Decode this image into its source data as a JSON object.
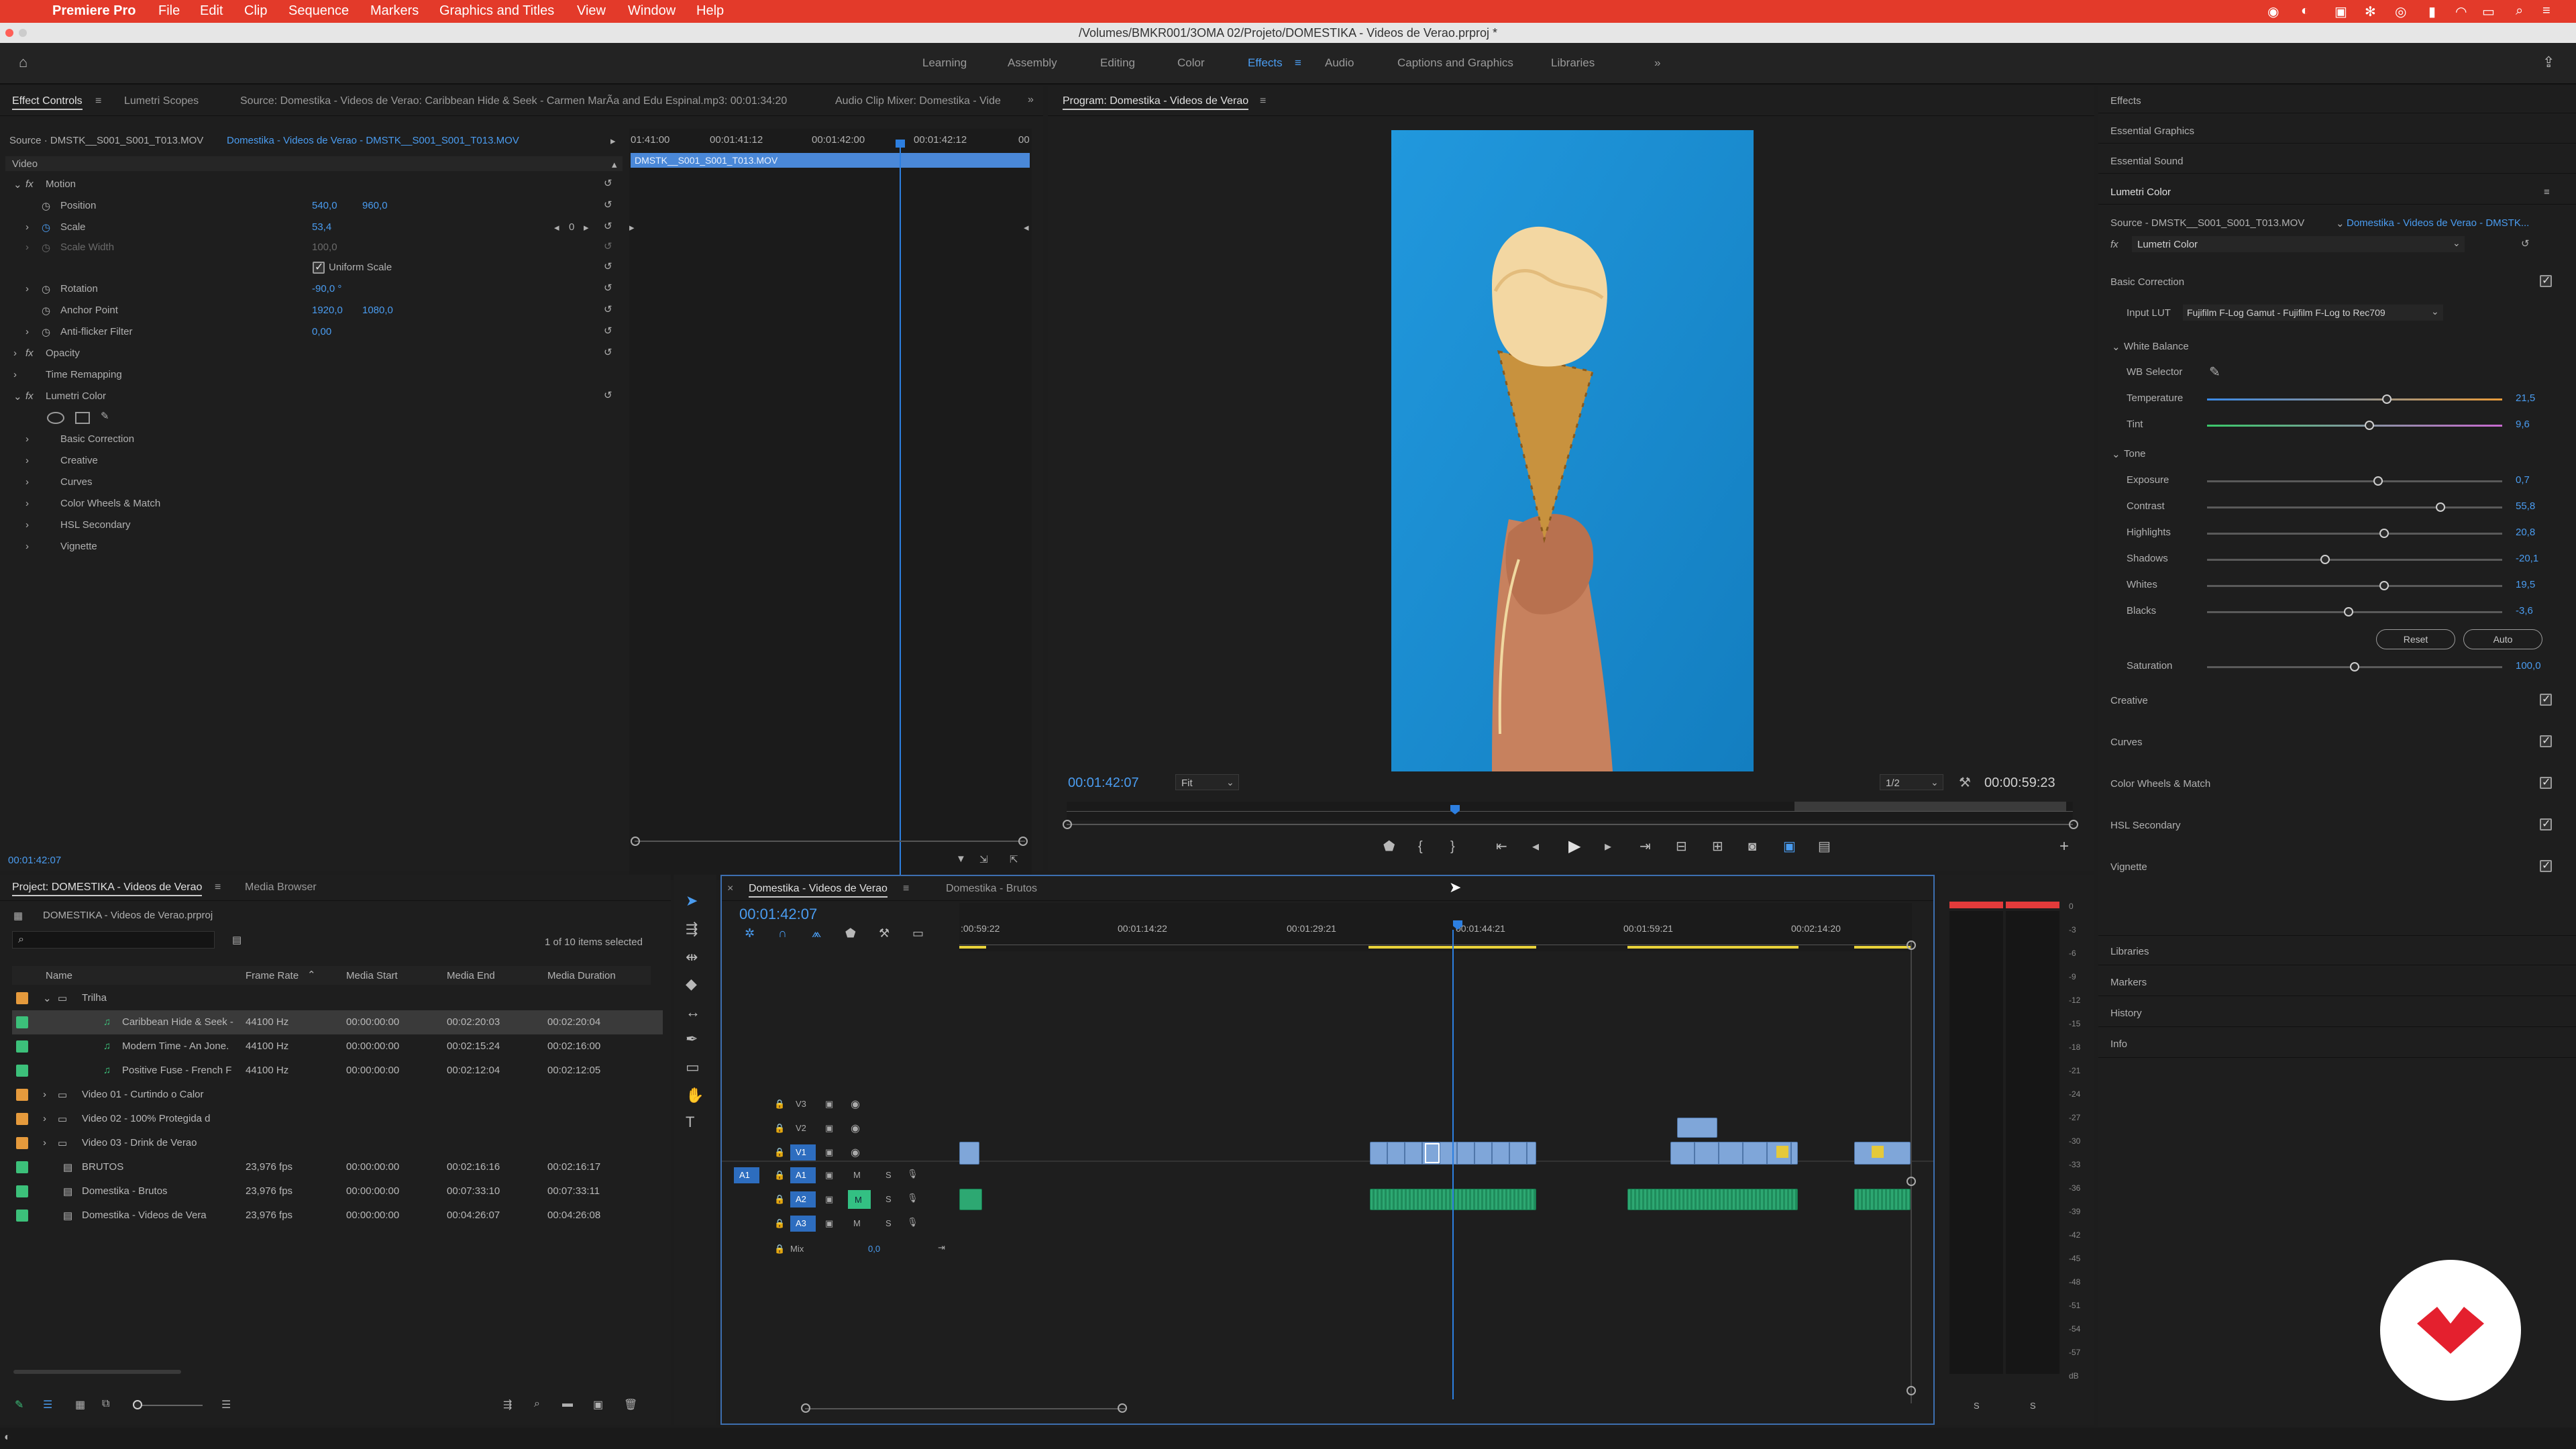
{
  "menubar": {
    "app": "Premiere Pro",
    "items": [
      "File",
      "Edit",
      "Clip",
      "Sequence",
      "Markers",
      "Graphics and Titles",
      "View",
      "Window",
      "Help"
    ]
  },
  "titlebar": {
    "path": "/Volumes/BMKR001/3OMA 02/Projeto/DOMESTIKA - Videos de Verao.prproj *"
  },
  "workspaces": {
    "items": [
      "Learning",
      "Assembly",
      "Editing",
      "Color",
      "Effects",
      "Audio",
      "Captions and Graphics",
      "Libraries"
    ],
    "active": "Effects"
  },
  "effect_controls": {
    "tabs": [
      "Effect Controls",
      "Lumetri Scopes",
      "Source: Domestika - Videos de Verao: Caribbean Hide & Seek - Carmen MarÃ­a and Edu Espinal.mp3: 00:01:34:20",
      "Audio Clip Mixer: Domestika - Vide"
    ],
    "source": "Source · DMSTK__S001_S001_T013.MOV",
    "sequence": "Domestika - Videos de Verao - DMSTK__S001_S001_T013.MOV",
    "ruler": [
      "01:41:00",
      "00:01:41:12",
      "00:01:42:00",
      "00:01:42:12",
      "00"
    ],
    "clip_label": "DMSTK__S001_S001_T013.MOV",
    "video_label": "Video",
    "motion": "Motion",
    "position_label": "Position",
    "position_x": "540,0",
    "position_y": "960,0",
    "scale_label": "Scale",
    "scale_val": "53,4",
    "scale_width_label": "Scale Width",
    "scale_width_val": "100,0",
    "uniform_label": "Uniform Scale",
    "rotation_label": "Rotation",
    "rotation_val": "-90,0 °",
    "anchor_label": "Anchor Point",
    "anchor_x": "1920,0",
    "anchor_y": "1080,0",
    "antiflicker_label": "Anti-flicker Filter",
    "antiflicker_val": "0,00",
    "opacity": "Opacity",
    "time_remap": "Time Remapping",
    "lumetri": "Lumetri Color",
    "lumetri_items": [
      "Basic Correction",
      "Creative",
      "Curves",
      "Color Wheels & Match",
      "HSL Secondary",
      "Vignette"
    ],
    "timecode": "00:01:42:07",
    "kf_value": "0"
  },
  "program": {
    "title": "Program: Domestika - Videos de Verao",
    "timecode": "00:01:42:07",
    "fit": "Fit",
    "resolution": "1/2",
    "duration": "00:00:59:23"
  },
  "effects_panel": {
    "headers": [
      "Effects",
      "Essential Graphics",
      "Essential Sound",
      "Lumetri Color"
    ],
    "source": "Source - DMSTK__S001_S001_T013.MOV",
    "sequence": "Domestika - Videos de Verao - DMSTK...",
    "fx": "Lumetri Color",
    "basic": "Basic Correction",
    "input_lut_label": "Input LUT",
    "input_lut": "Fujifilm F-Log Gamut - Fujifilm F-Log to Rec709",
    "white_balance": "White Balance",
    "wb_selector": "WB Selector",
    "tone": "Tone",
    "sliders": [
      {
        "label": "Temperature",
        "value": "21,5",
        "pos": 0.61,
        "accent": "#e89b3a"
      },
      {
        "label": "Tint",
        "value": "9,6",
        "pos": 0.55,
        "accent": "#c86ad0"
      },
      {
        "label": "Exposure",
        "value": "0,7",
        "pos": 0.58,
        "accent": "#555555"
      },
      {
        "label": "Contrast",
        "value": "55,8",
        "pos": 0.79,
        "accent": "#555555"
      },
      {
        "label": "Highlights",
        "value": "20,8",
        "pos": 0.6,
        "accent": "#555555"
      },
      {
        "label": "Shadows",
        "value": "-20,1",
        "pos": 0.4,
        "accent": "#555555"
      },
      {
        "label": "Whites",
        "value": "19,5",
        "pos": 0.6,
        "accent": "#555555"
      },
      {
        "label": "Blacks",
        "value": "-3,6",
        "pos": 0.48,
        "accent": "#555555"
      }
    ],
    "reset": "Reset",
    "auto": "Auto",
    "saturation_label": "Saturation",
    "saturation_value": "100,0",
    "saturation_pos": 0.5,
    "sections": [
      "Creative",
      "Curves",
      "Color Wheels & Match",
      "HSL Secondary",
      "Vignette"
    ],
    "bottom": [
      "Libraries",
      "Markers",
      "History",
      "Info"
    ]
  },
  "project": {
    "tabs": [
      "Project: DOMESTIKA - Videos de Verao",
      "Media Browser"
    ],
    "file": "DOMESTIKA - Videos de Verao.prproj",
    "count": "1 of 10 items selected",
    "columns": [
      "Name",
      "Frame Rate",
      "Media Start",
      "Media End",
      "Media Duration"
    ],
    "rows": [
      {
        "name": "Trilha",
        "fr": "",
        "ms": "",
        "me": "",
        "md": "",
        "color": "#e59a3c",
        "indent": 0,
        "type": "folder-open"
      },
      {
        "name": "Caribbean Hide & Seek -",
        "fr": "44100 Hz",
        "ms": "00:00:00:00",
        "me": "00:02:20:03",
        "md": "00:02:20:04",
        "color": "#3cc07a",
        "indent": 1,
        "type": "audio",
        "selected": true
      },
      {
        "name": "Modern Time - An Jone.",
        "fr": "44100 Hz",
        "ms": "00:00:00:00",
        "me": "00:02:15:24",
        "md": "00:02:16:00",
        "color": "#3cc07a",
        "indent": 1,
        "type": "audio"
      },
      {
        "name": "Positive Fuse - French F",
        "fr": "44100 Hz",
        "ms": "00:00:00:00",
        "me": "00:02:12:04",
        "md": "00:02:12:05",
        "color": "#3cc07a",
        "indent": 1,
        "type": "audio"
      },
      {
        "name": "Video 01 - Curtindo o Calor",
        "fr": "",
        "ms": "",
        "me": "",
        "md": "",
        "color": "#e59a3c",
        "indent": 0,
        "type": "folder"
      },
      {
        "name": "Video 02 - 100% Protegida d",
        "fr": "",
        "ms": "",
        "me": "",
        "md": "",
        "color": "#e59a3c",
        "indent": 0,
        "type": "folder"
      },
      {
        "name": "Video 03 - Drink de Verao",
        "fr": "",
        "ms": "",
        "me": "",
        "md": "",
        "color": "#e59a3c",
        "indent": 0,
        "type": "folder"
      },
      {
        "name": "BRUTOS",
        "fr": "23,976 fps",
        "ms": "00:00:00:00",
        "me": "00:02:16:16",
        "md": "00:02:16:17",
        "color": "#3cc07a",
        "indent": 0,
        "type": "seq"
      },
      {
        "name": "Domestika - Brutos",
        "fr": "23,976 fps",
        "ms": "00:00:00:00",
        "me": "00:07:33:10",
        "md": "00:07:33:11",
        "color": "#3cc07a",
        "indent": 0,
        "type": "seq"
      },
      {
        "name": "Domestika - Videos de Vera",
        "fr": "23,976 fps",
        "ms": "00:00:00:00",
        "me": "00:04:26:07",
        "md": "00:04:26:08",
        "color": "#3cc07a",
        "indent": 0,
        "type": "seq"
      }
    ]
  },
  "timeline": {
    "tabs": [
      "Domestika - Videos de Verao",
      "Domestika - Brutos"
    ],
    "timecode": "00:01:42:07",
    "ruler": [
      ":00:59:22",
      "00:01:14:22",
      "00:01:29:21",
      "00:01:44:21",
      "00:01:59:21",
      "00:02:14:20"
    ],
    "tracks_v": [
      "V3",
      "V2",
      "V1"
    ],
    "tracks_a": [
      "A1",
      "A2",
      "A3"
    ],
    "mix_label": "Mix",
    "mix_val": "0,0",
    "m_letter": "M",
    "s_letter": "S"
  },
  "meter": {
    "scale": [
      "0",
      "-3",
      "-6",
      "-9",
      "-12",
      "-15",
      "-18",
      "-21",
      "-24",
      "-27",
      "-30",
      "-33",
      "-36",
      "-39",
      "-42",
      "-45",
      "-48",
      "-51",
      "-54",
      "-57",
      "dB"
    ],
    "s_letters": [
      "S",
      "S"
    ]
  }
}
